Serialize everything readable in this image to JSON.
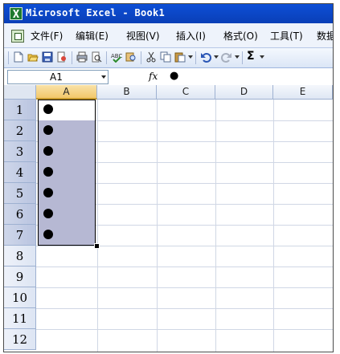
{
  "window": {
    "title": "Microsoft Excel - Book1"
  },
  "menu": {
    "items": [
      "文件(F)",
      "编辑(E)",
      "视图(V)",
      "插入(I)",
      "格式(O)",
      "工具(T)",
      "数据"
    ]
  },
  "toolbar": {
    "icons": [
      "new-icon",
      "open-icon",
      "save-icon",
      "permission-icon",
      "print-icon",
      "print-preview-icon",
      "spelling-icon",
      "research-icon",
      "cut-icon",
      "copy-icon",
      "paste-icon",
      "undo-icon",
      "redo-icon",
      "autosum-icon"
    ],
    "sigma": "Σ"
  },
  "formula_bar": {
    "name_box": "A1",
    "fx_label": "fx",
    "content": "●"
  },
  "sheet": {
    "columns": [
      "A",
      "B",
      "C",
      "D",
      "E"
    ],
    "rows": [
      "1",
      "2",
      "3",
      "4",
      "5",
      "6",
      "7",
      "8",
      "9",
      "10",
      "11",
      "12"
    ],
    "selected_range": "A1:A7",
    "active_cell": "A1",
    "column_a_values": [
      "●",
      "●",
      "●",
      "●",
      "●",
      "●",
      "●"
    ]
  },
  "colors": {
    "title_bar": "#0a3fb7",
    "selection": "#b6b8d3",
    "header": "#dfe7f4",
    "selected_col_header": "#f3c86b"
  }
}
